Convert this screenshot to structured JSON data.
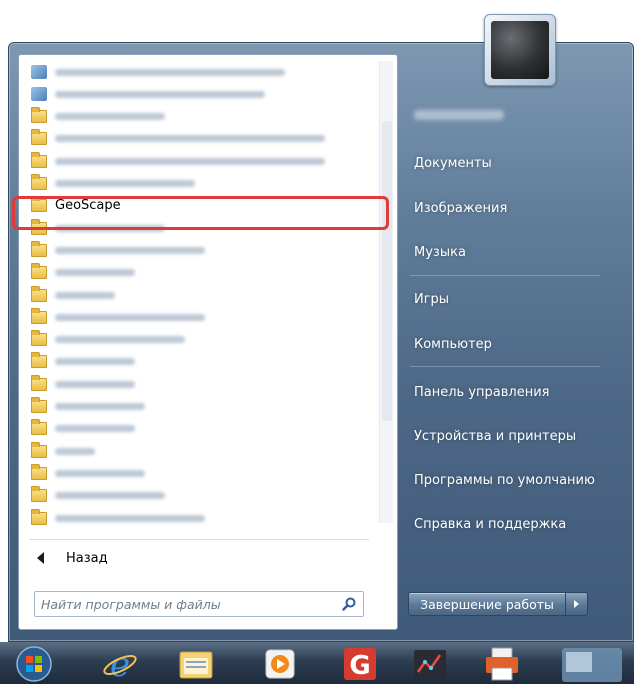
{
  "programs_list": {
    "items": [
      {
        "label": "",
        "icon": "app-icon",
        "selected": false
      },
      {
        "label": "",
        "icon": "app-icon",
        "selected": false
      },
      {
        "label": "",
        "icon": "folder-icon",
        "selected": false
      },
      {
        "label": "",
        "icon": "folder-icon",
        "selected": false
      },
      {
        "label": "",
        "icon": "folder-icon",
        "selected": false
      },
      {
        "label": "",
        "icon": "folder-icon",
        "selected": false
      },
      {
        "label": "GeoScape",
        "icon": "folder-icon",
        "selected": true
      },
      {
        "label": "",
        "icon": "folder-icon",
        "selected": false
      },
      {
        "label": "",
        "icon": "folder-icon",
        "selected": false
      },
      {
        "label": "",
        "icon": "folder-icon",
        "selected": false
      },
      {
        "label": "",
        "icon": "folder-icon",
        "selected": false
      },
      {
        "label": "",
        "icon": "folder-icon",
        "selected": false
      },
      {
        "label": "",
        "icon": "folder-icon",
        "selected": false
      },
      {
        "label": "",
        "icon": "folder-icon",
        "selected": false
      },
      {
        "label": "",
        "icon": "folder-icon",
        "selected": false
      },
      {
        "label": "",
        "icon": "folder-icon",
        "selected": false
      },
      {
        "label": "",
        "icon": "folder-icon",
        "selected": false
      },
      {
        "label": "",
        "icon": "folder-icon",
        "selected": false
      },
      {
        "label": "",
        "icon": "folder-icon",
        "selected": false
      },
      {
        "label": "",
        "icon": "folder-icon",
        "selected": false
      },
      {
        "label": "",
        "icon": "folder-icon",
        "selected": false
      }
    ]
  },
  "back": {
    "label": "Назад"
  },
  "search": {
    "placeholder": "Найти программы и файлы"
  },
  "right_menu": {
    "items": [
      {
        "label": "Документы"
      },
      {
        "label": "Изображения"
      },
      {
        "label": "Музыка"
      },
      {
        "label": "Игры"
      },
      {
        "label": "Компьютер"
      },
      {
        "label": "Панель управления"
      },
      {
        "label": "Устройства и принтеры"
      },
      {
        "label": "Программы по умолчанию"
      },
      {
        "label": "Справка и поддержка"
      }
    ]
  },
  "shutdown": {
    "label": "Завершение работы"
  },
  "taskbar": {
    "icons": [
      "start-orb-icon",
      "internet-explorer-icon",
      "file-explorer-icon",
      "media-player-icon",
      "g-app-icon",
      "chart-app-icon",
      "printer-app-icon",
      "window-thumbnail-icon"
    ]
  },
  "colors": {
    "highlight": "#e03a3a",
    "menu_frame": "#5f7c99",
    "taskbar": "#2d3e52"
  }
}
